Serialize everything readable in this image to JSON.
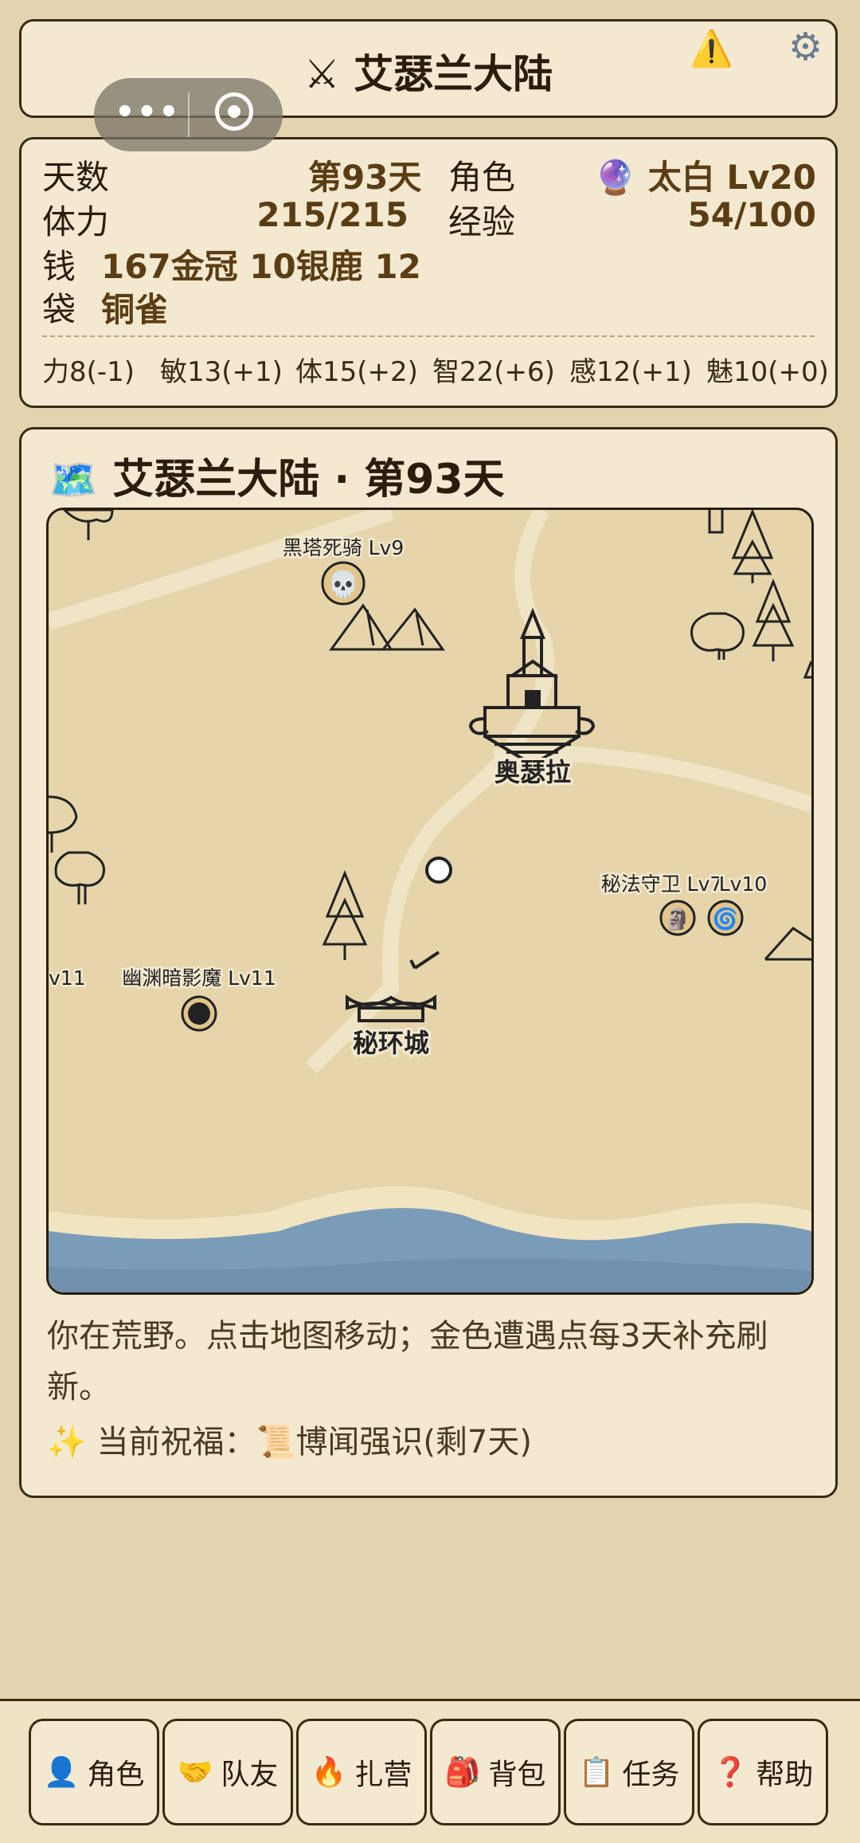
{
  "title": "⚔ 艾瑟兰大陆",
  "icons": {
    "warning": "⚠️",
    "settings": "⚙"
  },
  "capsule": {
    "more": "•••"
  },
  "stats": {
    "day_label": "天数",
    "day_value": "第93天",
    "role_label": "角色",
    "role_value": "🔮 太白 Lv20",
    "stamina_label": "体力",
    "stamina_value": "215/215",
    "exp_label": "经验",
    "exp_value": "54/100",
    "purse_label_1": "钱",
    "purse_label_2": "袋",
    "purse_value_1": "167金冠 10银鹿 12",
    "purse_value_2": "铜雀"
  },
  "attributes": [
    "力8(-1)",
    "敏13(+1)",
    "体15(+2)",
    "智22(+6)",
    "感12(+1)",
    "魅10(+0)"
  ],
  "map": {
    "icon": "🗺️",
    "title": "艾瑟兰大陆 · 第93天",
    "enemies": {
      "black_tower": "黑塔死骑 Lv9",
      "guardian": "秘法守卫 Lv7",
      "guardian_lv": "Lv10",
      "abyss": "幽渊暗影魔 Lv11",
      "edge": "v11"
    },
    "cities": {
      "osella": "奥瑟拉",
      "mihuan": "秘环城"
    }
  },
  "description": "你在荒野。点击地图移动；金色遭遇点每3天补充刷新。",
  "blessing": "✨ 当前祝福：📜博闻强识(剩7天)",
  "nav": [
    {
      "icon": "👤",
      "label": "角色"
    },
    {
      "icon": "🤝",
      "label": "队友"
    },
    {
      "icon": "🔥",
      "label": "扎营"
    },
    {
      "icon": "🎒",
      "label": "背包"
    },
    {
      "icon": "📋",
      "label": "任务"
    },
    {
      "icon": "❓",
      "label": "帮助"
    }
  ]
}
